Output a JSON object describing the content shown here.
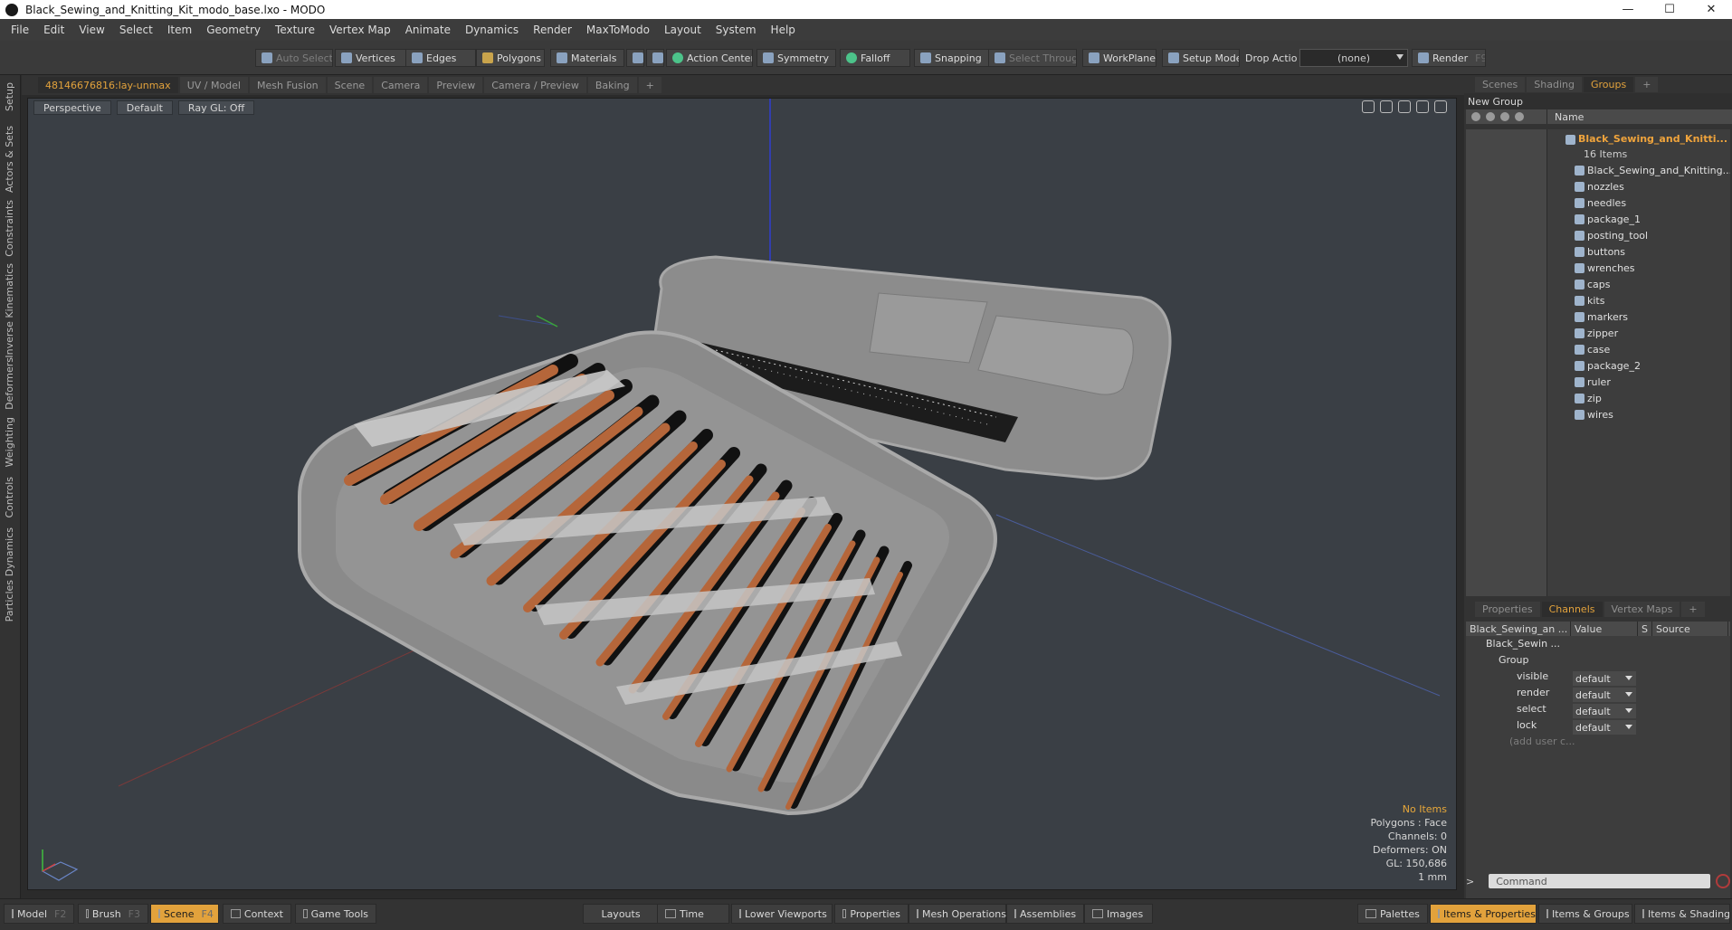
{
  "window": {
    "title": "Black_Sewing_and_Knitting_Kit_modo_base.lxo - MODO",
    "controls": [
      "—",
      "☐",
      "✕"
    ]
  },
  "menu": [
    "File",
    "Edit",
    "View",
    "Select",
    "Item",
    "Geometry",
    "Texture",
    "Vertex Map",
    "Animate",
    "Dynamics",
    "Render",
    "MaxToModo",
    "Layout",
    "System",
    "Help"
  ],
  "toolbar": {
    "auto_select": "Auto Select",
    "vertices": "Vertices",
    "edges": "Edges",
    "polygons": "Polygons",
    "materials": "Materials",
    "action_center": "Action Center",
    "symmetry": "Symmetry",
    "falloff": "Falloff",
    "snapping": "Snapping",
    "select_through": "Select Through",
    "workplane": "WorkPlane",
    "setup_mode": "Setup Mode",
    "drop_action": "Drop Action",
    "drop_value": "(none)",
    "render": "Render",
    "render_key": "F9"
  },
  "left_tabs": [
    "Setup",
    "Actors & Sets",
    "Constraints",
    "Inverse Kinematics",
    "Deformers",
    "Weighting",
    "Controls",
    "Dynamics",
    "Particles"
  ],
  "viewport_tabs": [
    "48146676816:lay-unmax",
    "UV / Model",
    "Mesh Fusion",
    "Scene",
    "Camera",
    "Preview",
    "Camera / Preview",
    "Baking",
    "+"
  ],
  "viewport": {
    "perspective": "Perspective",
    "shading": "Default",
    "raygl": "Ray GL: Off",
    "info": {
      "items": "No Items",
      "polygons": "Polygons : Face",
      "channels": "Channels: 0",
      "deformers": "Deformers: ON",
      "gl": "GL: 150,686",
      "unit": "1 mm"
    }
  },
  "scene_tabs": [
    "Scenes",
    "Shading",
    "Groups",
    "+"
  ],
  "groups": {
    "new_group": "New Group",
    "name_header": "Name",
    "root": "Black_Sewing_and_Knitti...",
    "root_count": "16 Items",
    "items": [
      "Black_Sewing_and_Knitting...",
      "nozzles",
      "needles",
      "package_1",
      "posting_tool",
      "buttons",
      "wrenches",
      "caps",
      "kits",
      "markers",
      "zipper",
      "case",
      "package_2",
      "ruler",
      "zip",
      "wires"
    ]
  },
  "props_tabs": [
    "Properties",
    "Channels",
    "Vertex Maps",
    "+"
  ],
  "channels": {
    "header": [
      "Black_Sewing_an ...",
      "Value",
      "S",
      "Source"
    ],
    "item": "Black_Sewin ...",
    "group": "Group",
    "rows": [
      {
        "name": "visible",
        "value": "default"
      },
      {
        "name": "render",
        "value": "default"
      },
      {
        "name": "select",
        "value": "default"
      },
      {
        "name": "lock",
        "value": "default"
      }
    ],
    "add_user": "(add user c..."
  },
  "command": {
    "placeholder": "Command",
    "prompt": ">"
  },
  "bottom": {
    "left": [
      {
        "label": "Model",
        "key": "F2"
      },
      {
        "label": "Brush",
        "key": "F3"
      },
      {
        "label": "Scene",
        "key": "F4"
      },
      {
        "label": "Context",
        "key": ""
      },
      {
        "label": "Game Tools",
        "key": ""
      }
    ],
    "middle": [
      "Layouts",
      "Time",
      "Lower Viewports",
      "Properties",
      "Mesh Operations",
      "Assemblies",
      "Images"
    ],
    "right": [
      "Palettes",
      "Items & Properties",
      "Items & Groups",
      "Items & Shading"
    ]
  },
  "colors": {
    "accent": "#e2a23c",
    "viewport_bg": "#3a3f45",
    "case_grey": "#8c8c8c",
    "needle_brown": "#b5663a"
  }
}
